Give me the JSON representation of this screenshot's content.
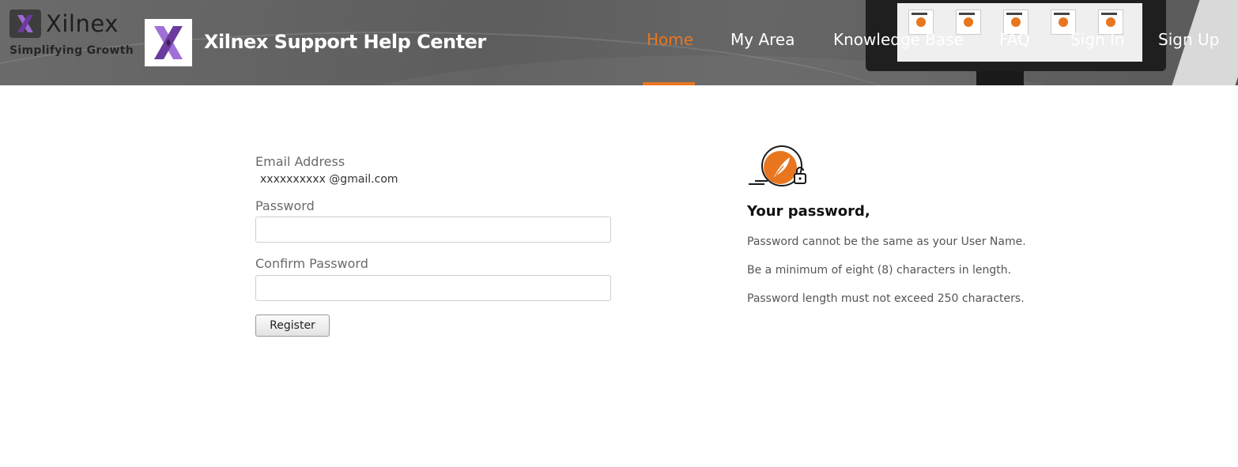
{
  "brand": {
    "name": "Xilnex",
    "tagline": "Simplifying Growth",
    "site_title": "Xilnex Support Help Center"
  },
  "nav": {
    "items": [
      {
        "label": "Home",
        "active": true
      },
      {
        "label": "My Area",
        "active": false
      },
      {
        "label": "Knowledge Base",
        "active": false
      },
      {
        "label": "FAQ",
        "active": false
      },
      {
        "label": "Sign In",
        "active": false
      },
      {
        "label": "Sign Up",
        "active": false
      }
    ]
  },
  "form": {
    "email_label": "Email Address",
    "email_value": "xxxxxxxxxx @gmail.com",
    "password_label": "Password",
    "password_value": "",
    "confirm_label": "Confirm Password",
    "confirm_value": "",
    "register_label": "Register"
  },
  "info": {
    "icon": "password-lock-icon",
    "title": "Your password,",
    "rules": [
      "Password cannot be the same as your User Name.",
      "Be a minimum of eight (8) characters in length.",
      "Password length must not exceed 250 characters."
    ]
  },
  "colors": {
    "accent": "#e8761f",
    "header_bg": "#5f5f5f",
    "logo_purple": "#8a4fc0"
  }
}
